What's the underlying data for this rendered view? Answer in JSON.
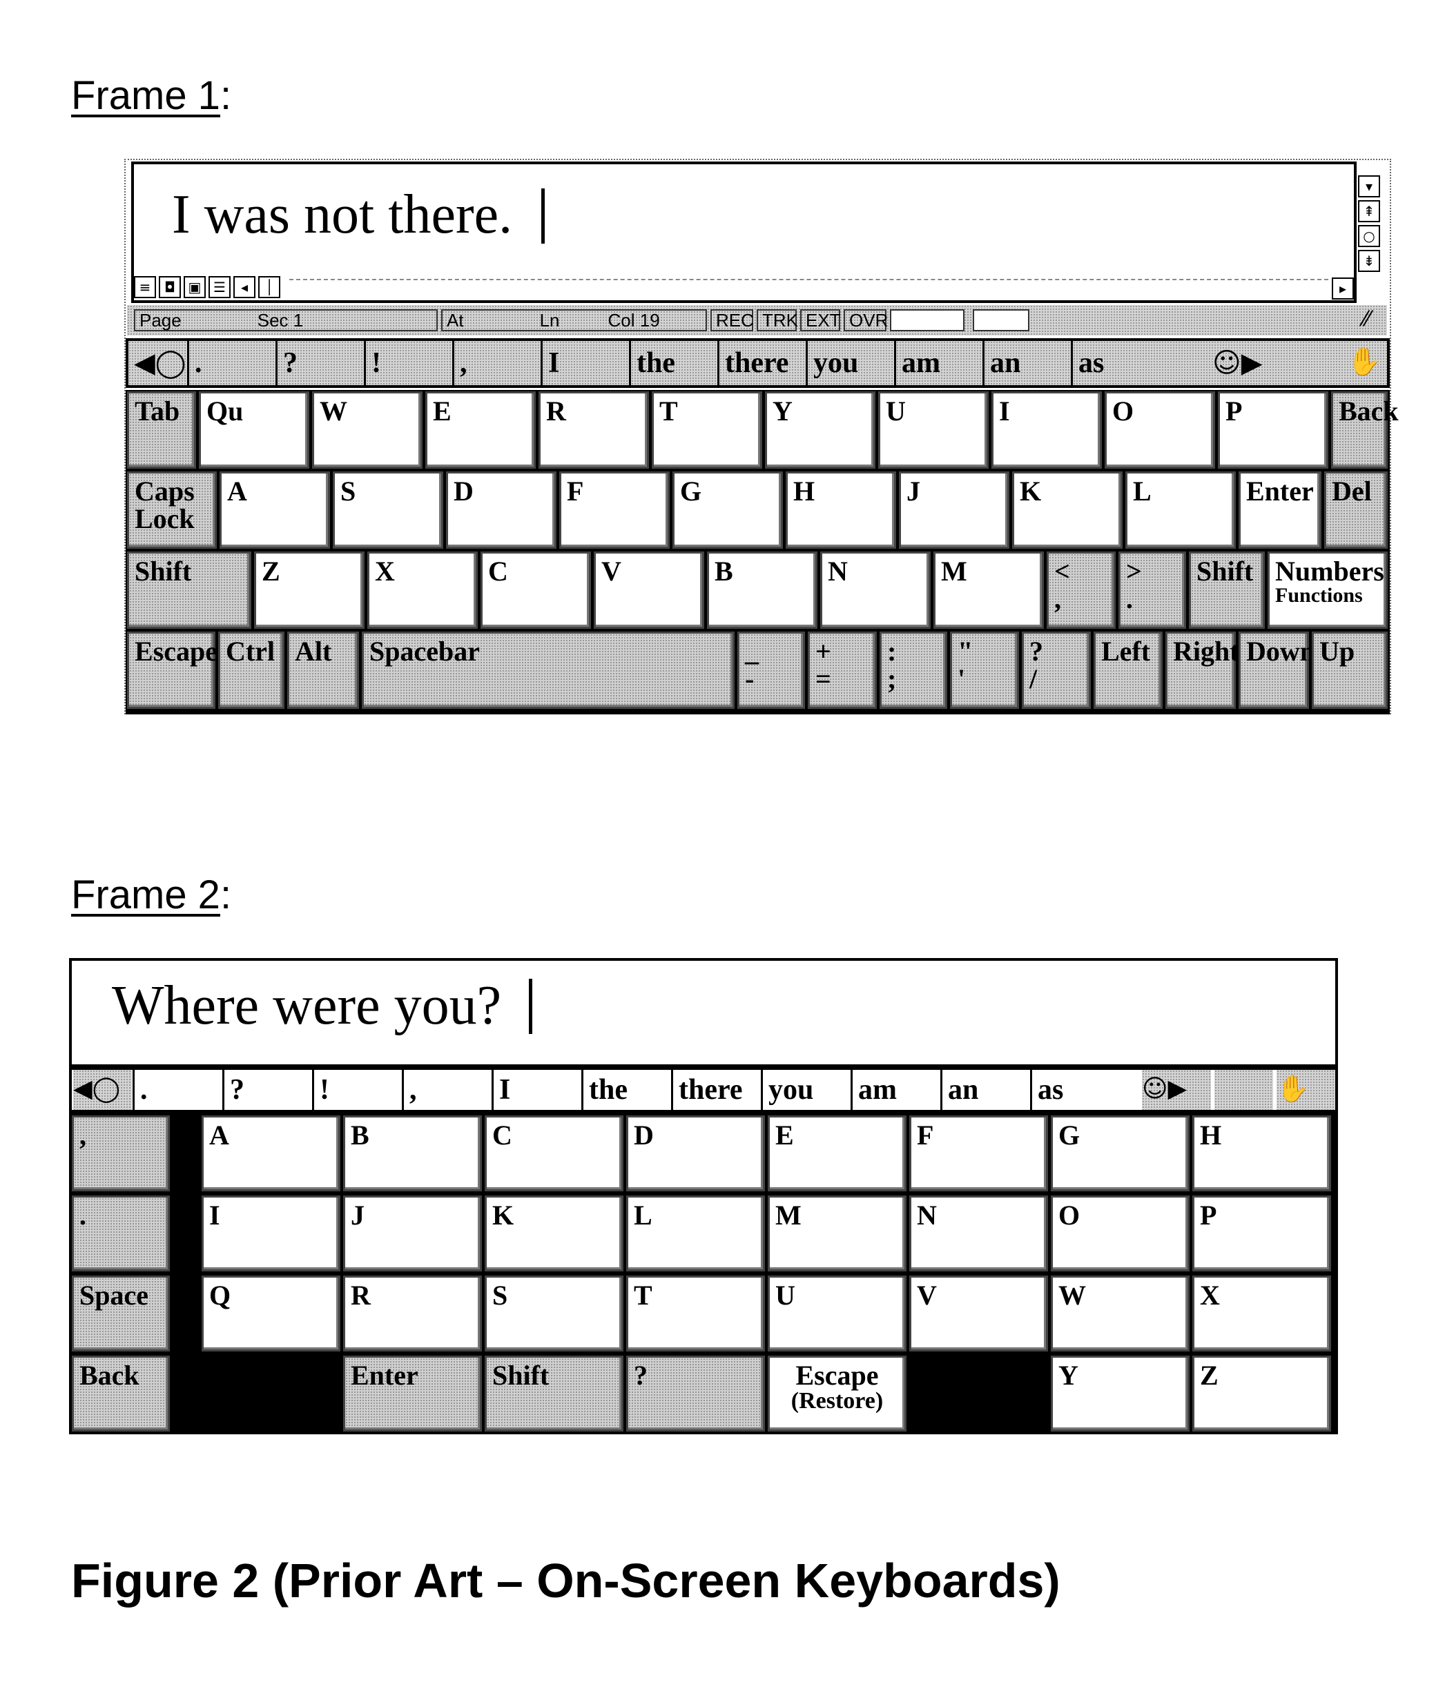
{
  "frame1": {
    "label": "Frame 1",
    "label_suffix": ":",
    "text": "I was not there.",
    "status": {
      "page": "Page",
      "sec": "Sec 1",
      "at": "At",
      "ln": "Ln",
      "col": "Col 19",
      "rec": "REC",
      "trk": "TRK",
      "ext": "EXT",
      "ovr": "OVR"
    },
    "view_buttons": [
      "≡",
      "◘",
      "▣",
      "☰",
      "◂",
      "│"
    ],
    "scroll_buttons": [
      "▾",
      "⇞",
      "○",
      "⇟"
    ],
    "scroll_right": "▸",
    "wordbar": {
      "prev_icon": "◀",
      "words": [
        ".",
        "?",
        "!",
        ",",
        "I",
        "the",
        "there",
        "you",
        "am",
        "an",
        "as"
      ],
      "next_icon": "▶"
    },
    "rows": [
      [
        {
          "label": "Tab",
          "style": "gray"
        },
        {
          "label": "Qu"
        },
        {
          "label": "W"
        },
        {
          "label": "E"
        },
        {
          "label": "R"
        },
        {
          "label": "T"
        },
        {
          "label": "Y"
        },
        {
          "label": "U"
        },
        {
          "label": "I"
        },
        {
          "label": "O"
        },
        {
          "label": "P"
        },
        {
          "label": "Back",
          "style": "gray"
        }
      ],
      [
        {
          "label": "Caps",
          "sub": "Lock",
          "style": "gray"
        },
        {
          "label": "A"
        },
        {
          "label": "S"
        },
        {
          "label": "D"
        },
        {
          "label": "F"
        },
        {
          "label": "G"
        },
        {
          "label": "H"
        },
        {
          "label": "J"
        },
        {
          "label": "K"
        },
        {
          "label": "L"
        },
        {
          "label": "Enter",
          "style": "white"
        },
        {
          "label": "Del",
          "style": "gray"
        }
      ],
      [
        {
          "label": "Shift",
          "style": "gray"
        },
        {
          "label": "Z"
        },
        {
          "label": "X"
        },
        {
          "label": "C"
        },
        {
          "label": "V"
        },
        {
          "label": "B"
        },
        {
          "label": "N"
        },
        {
          "label": "M"
        },
        {
          "label": "<",
          "sub": ",",
          "style": "gray"
        },
        {
          "label": ">",
          "sub": ".",
          "style": "gray"
        },
        {
          "label": "Shift",
          "style": "gray"
        },
        {
          "label": "Numbers",
          "sub": "Functions",
          "style": "white"
        }
      ],
      [
        {
          "label": "Escape",
          "style": "gray"
        },
        {
          "label": "Ctrl",
          "style": "gray"
        },
        {
          "label": "Alt",
          "style": "gray"
        },
        {
          "label": "Spacebar",
          "style": "gray"
        },
        {
          "label": "_",
          "sub": "-",
          "style": "gray"
        },
        {
          "label": "+",
          "sub": "=",
          "style": "gray"
        },
        {
          "label": ":",
          "sub": ";",
          "style": "gray"
        },
        {
          "label": "\"",
          "sub": "'",
          "style": "gray"
        },
        {
          "label": "?",
          "sub": "/",
          "style": "gray"
        },
        {
          "label": "Left",
          "style": "gray"
        },
        {
          "label": "Right",
          "style": "gray"
        },
        {
          "label": "Down",
          "style": "gray"
        },
        {
          "label": "Up",
          "style": "gray"
        }
      ]
    ]
  },
  "frame2": {
    "label": "Frame 2",
    "label_suffix": ":",
    "text": "Where were you?",
    "wordbar": {
      "prev_icon": "◀",
      "words": [
        ".",
        "?",
        "!",
        ",",
        "I",
        "the",
        "there",
        "you",
        "am",
        "an",
        "as"
      ],
      "next_icon": "▶"
    },
    "rows": [
      [
        {
          "label": ",",
          "style": "gray"
        },
        {
          "label": "",
          "style": "black"
        },
        {
          "label": "A"
        },
        {
          "label": "B"
        },
        {
          "label": "C"
        },
        {
          "label": "D"
        },
        {
          "label": "E"
        },
        {
          "label": "F"
        },
        {
          "label": "G"
        },
        {
          "label": "H"
        }
      ],
      [
        {
          "label": ".",
          "style": "gray"
        },
        {
          "label": "",
          "style": "black"
        },
        {
          "label": "I"
        },
        {
          "label": "J"
        },
        {
          "label": "K"
        },
        {
          "label": "L"
        },
        {
          "label": "M"
        },
        {
          "label": "N"
        },
        {
          "label": "O"
        },
        {
          "label": "P"
        }
      ],
      [
        {
          "label": "Space",
          "style": "gray"
        },
        {
          "label": "",
          "style": "black"
        },
        {
          "label": "Q"
        },
        {
          "label": "R"
        },
        {
          "label": "S"
        },
        {
          "label": "T"
        },
        {
          "label": "U"
        },
        {
          "label": "V"
        },
        {
          "label": "W"
        },
        {
          "label": "X"
        }
      ],
      [
        {
          "label": "Back",
          "style": "gray"
        },
        {
          "label": "",
          "style": "black"
        },
        {
          "label": "",
          "style": "black"
        },
        {
          "label": "Enter",
          "style": "gray"
        },
        {
          "label": "Shift",
          "style": "gray"
        },
        {
          "label": "?",
          "style": "gray"
        },
        {
          "label": "Escape",
          "sub": "(Restore)",
          "style": "white-center"
        },
        {
          "label": "",
          "style": "black"
        },
        {
          "label": "Y"
        },
        {
          "label": "Z"
        }
      ]
    ]
  },
  "caption": "Figure 2 (Prior Art – On-Screen Keyboards)"
}
